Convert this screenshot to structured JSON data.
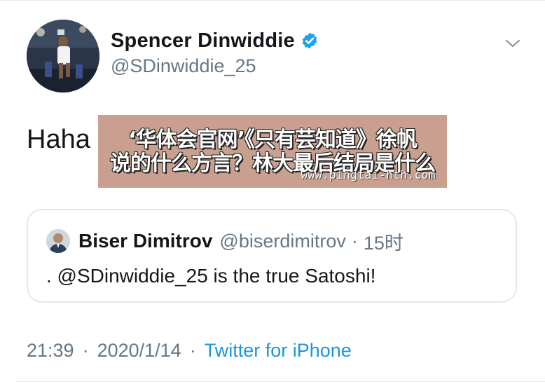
{
  "tweet": {
    "author": {
      "display_name": "Spencer Dinwiddie",
      "handle": "@SDinwiddie_25",
      "verified": true
    },
    "text": "Haha I w",
    "timestamp": "21:39",
    "date": "2020/1/14",
    "source": "Twitter for iPhone",
    "separator": "·"
  },
  "quoted_tweet": {
    "author": {
      "display_name": "Biser Dimitrov",
      "handle": "@biserdimitrov"
    },
    "separator": "·",
    "time": "15时",
    "text": ". @SDinwiddie_25 is the true Satoshi!"
  },
  "overlay": {
    "line1": "‘华体会官网’《只有芸知道》徐帆",
    "line2": "说的什么方言？林大最后结局是什么",
    "url": "www.pingtai-hth.com"
  },
  "colors": {
    "link_blue": "#1b95e0",
    "verified_blue": "#1da1f2",
    "secondary_text": "#657786",
    "overlay_bg": "#c9a08f"
  },
  "icons": {
    "verified": "verified-badge-icon",
    "menu": "chevron-down-icon"
  }
}
